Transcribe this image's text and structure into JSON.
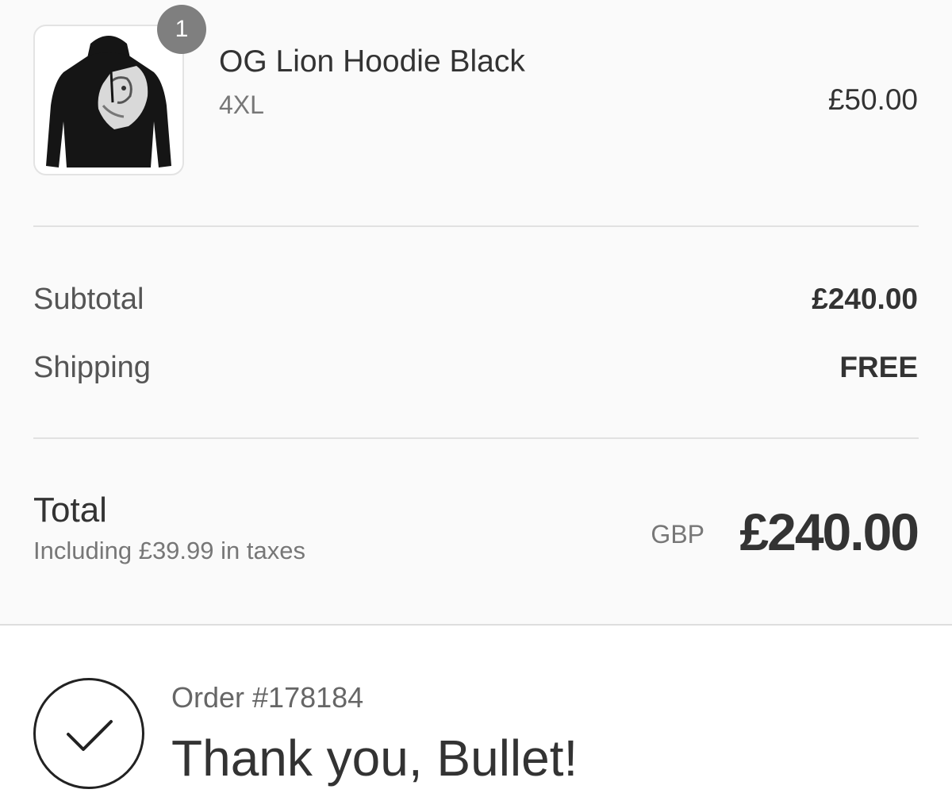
{
  "product": {
    "quantity": "1",
    "name": "OG Lion Hoodie Black",
    "variant": "4XL",
    "price": "£50.00",
    "image_icon": "hoodie-image"
  },
  "totals": {
    "subtotal_label": "Subtotal",
    "subtotal_value": "£240.00",
    "shipping_label": "Shipping",
    "shipping_value": "FREE",
    "total_label": "Total",
    "tax_note": "Including £39.99 in taxes",
    "currency": "GBP",
    "total_value": "£240.00"
  },
  "confirmation": {
    "icon": "checkmark-circle-icon",
    "order_number": "Order #178184",
    "thank_you": "Thank you, Bullet!"
  },
  "colors": {
    "summary_background": "#fafafa",
    "badge": "#7f7f7f",
    "text": "#333333"
  }
}
